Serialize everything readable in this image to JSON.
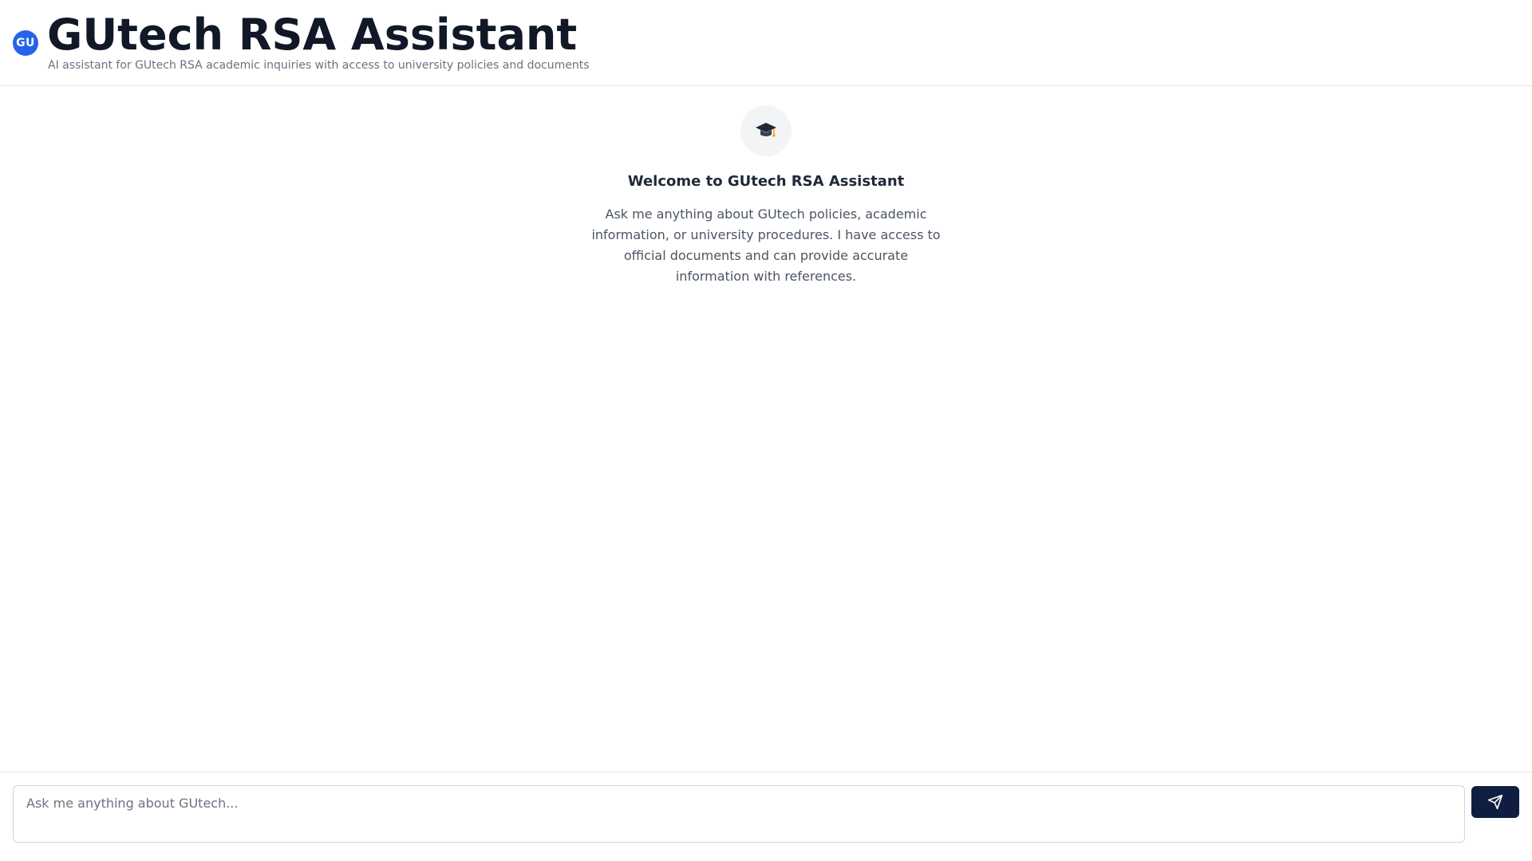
{
  "header": {
    "avatar_initials": "GU",
    "title": "GUtech RSA Assistant",
    "subtitle": "AI assistant for GUtech RSA academic inquiries with access to university policies and documents"
  },
  "welcome": {
    "icon": "graduation-cap-icon",
    "title": "Welcome to GUtech RSA Assistant",
    "text": "Ask me anything about GUtech policies, academic information, or university procedures. I have access to official documents and can provide accurate information with references."
  },
  "composer": {
    "placeholder": "Ask me anything about GUtech...",
    "value": "",
    "send_icon": "send-icon"
  },
  "colors": {
    "accent": "#2563eb",
    "send_button": "#0f1d40",
    "border": "#e5e7eb"
  }
}
